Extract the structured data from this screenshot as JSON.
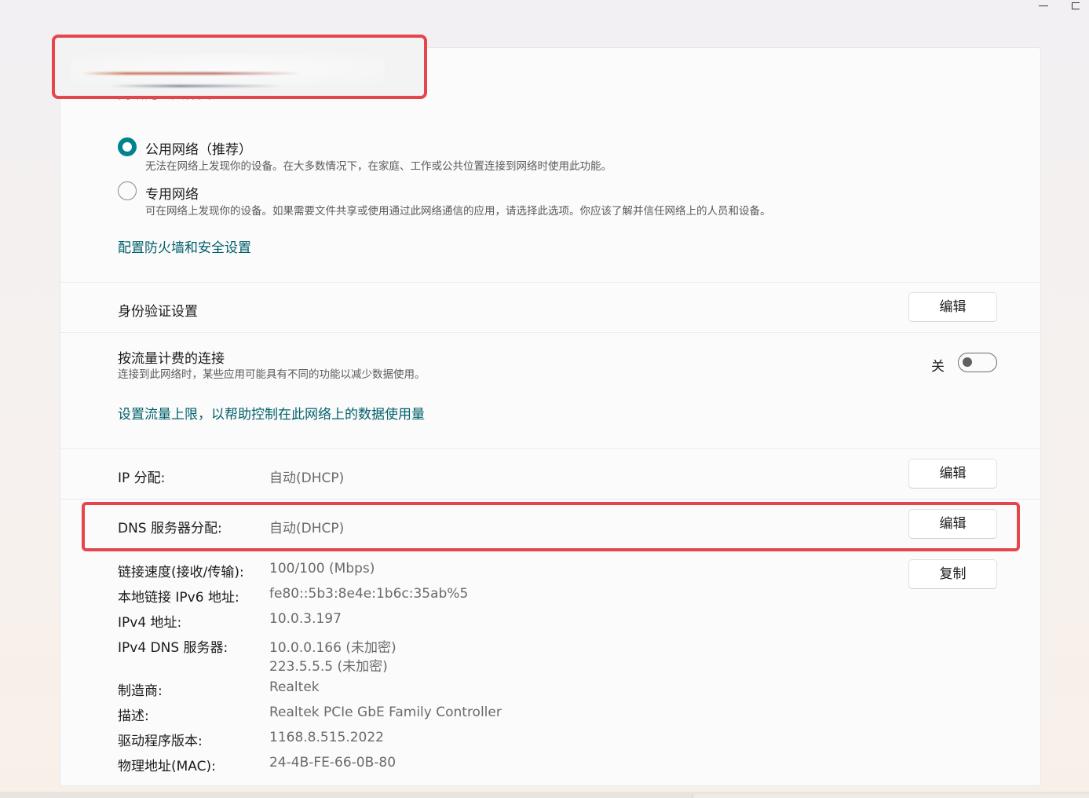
{
  "window": {
    "minimize_icon": "minimize-icon",
    "maximize_icon": "restore-icon"
  },
  "header": {
    "title_redacted": true,
    "cut_heading": "网络配置文件类型"
  },
  "network_profile": {
    "options": [
      {
        "label": "公用网络（推荐）",
        "description": "无法在网络上发现你的设备。在大多数情况下，在家庭、工作或公共位置连接到网络时使用此功能。",
        "selected": true
      },
      {
        "label": "专用网络",
        "description": "可在网络上发现你的设备。如果需要文件共享或使用通过此网络通信的应用，请选择此选项。你应该了解并信任网络上的人员和设备。",
        "selected": false
      }
    ],
    "firewall_link": "配置防火墙和安全设置"
  },
  "auth": {
    "label": "身份验证设置",
    "button": "编辑"
  },
  "metered": {
    "label": "按流量计费的连接",
    "description": "连接到此网络时，某些应用可能具有不同的功能以减少数据使用。",
    "state": "关",
    "enabled": false,
    "link": "设置流量上限，以帮助控制在此网络上的数据使用量"
  },
  "ip_assignment": {
    "label": "IP 分配:",
    "value": "自动(DHCP)",
    "button": "编辑"
  },
  "dns_assignment": {
    "label": "DNS 服务器分配:",
    "value": "自动(DHCP)",
    "button": "编辑"
  },
  "properties": {
    "copy_button": "复制",
    "link_speed": {
      "label": "链接速度(接收/传输):",
      "value": "100/100 (Mbps)"
    },
    "ipv6": {
      "label": "本地链接 IPv6 地址:",
      "value": "fe80::5b3:8e4e:1b6c:35ab%5"
    },
    "ipv4": {
      "label": "IPv4 地址:",
      "value": "10.0.3.197"
    },
    "ipv4_dns": {
      "label": "IPv4 DNS 服务器:",
      "value1": "10.0.0.166 (未加密)",
      "value2": "223.5.5.5 (未加密)"
    },
    "manufacturer": {
      "label": "制造商:",
      "value": "Realtek"
    },
    "description": {
      "label": "描述:",
      "value": "Realtek PCIe GbE Family Controller"
    },
    "driver": {
      "label": "驱动程序版本:",
      "value": "1168.8.515.2022"
    },
    "mac": {
      "label": "物理地址(MAC):",
      "value": "24-4B-FE-66-0B-80"
    }
  },
  "colors": {
    "accent": "#00838f",
    "link": "#005f6b",
    "highlight": "#e4464b"
  }
}
